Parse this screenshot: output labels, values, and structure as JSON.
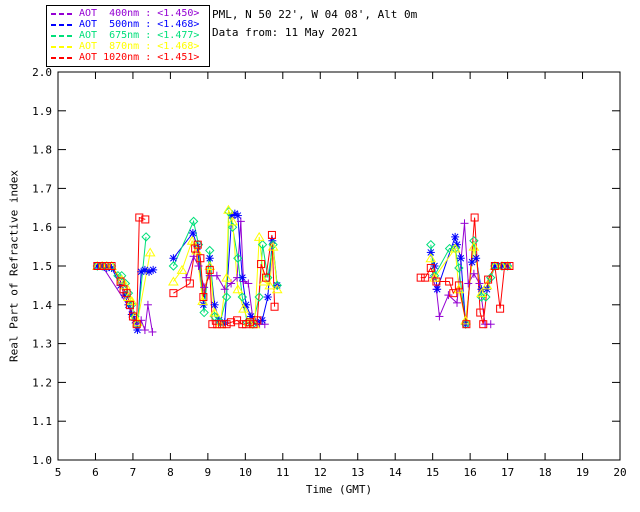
{
  "header": {
    "line1": "PML, N 50 22', W 04 08', Alt 0m",
    "line2": "Data from: 11 May 2021"
  },
  "chart_data": {
    "type": "line",
    "title": "",
    "xlabel": "Time (GMT)",
    "ylabel": "Real Part of Refractive index",
    "xlim": [
      5,
      20
    ],
    "ylim": [
      1.0,
      2.0
    ],
    "x_ticks": [
      "5",
      "6",
      "7",
      "8",
      "9",
      "10",
      "11",
      "12",
      "13",
      "14",
      "15",
      "16",
      "17",
      "18",
      "19",
      "20"
    ],
    "y_ticks": [
      "1.0",
      "1.1",
      "1.2",
      "1.3",
      "1.4",
      "1.5",
      "1.6",
      "1.7",
      "1.8",
      "1.9",
      "2.0"
    ],
    "grid": false,
    "legend_position": "top-left-outside",
    "axis_color": "#000000",
    "series": [
      {
        "name": "AOT 400nm",
        "legend_label": "AOT  400nm : <1.450>",
        "mean_value": "1.450",
        "color": "#9400D3",
        "marker": "plus",
        "segments": [
          [
            [
              6.05,
              1.5
            ],
            [
              6.18,
              1.5
            ],
            [
              6.92,
              1.39
            ],
            [
              7.0,
              1.37
            ],
            [
              7.1,
              1.345
            ],
            [
              7.22,
              1.36
            ],
            [
              7.32,
              1.335
            ],
            [
              7.4,
              1.4
            ],
            [
              7.52,
              1.33
            ]
          ],
          [
            [
              8.42,
              1.47
            ],
            [
              8.62,
              1.525
            ],
            [
              8.75,
              1.5
            ],
            [
              8.9,
              1.445
            ],
            [
              9.05,
              1.475
            ],
            [
              9.24,
              1.475
            ],
            [
              9.45,
              1.44
            ],
            [
              9.62,
              1.455
            ],
            [
              9.78,
              1.47
            ],
            [
              9.88,
              1.615
            ],
            [
              9.95,
              1.46
            ],
            [
              10.08,
              1.455
            ],
            [
              10.22,
              1.35
            ],
            [
              10.38,
              1.35
            ],
            [
              10.52,
              1.35
            ]
          ],
          [
            [
              15.0,
              1.47
            ],
            [
              15.1,
              1.44
            ],
            [
              15.18,
              1.37
            ],
            [
              15.42,
              1.425
            ],
            [
              15.65,
              1.405
            ],
            [
              15.85,
              1.61
            ],
            [
              15.95,
              1.455
            ],
            [
              16.1,
              1.48
            ],
            [
              16.25,
              1.455
            ],
            [
              16.4,
              1.35
            ],
            [
              16.55,
              1.35
            ]
          ]
        ]
      },
      {
        "name": "AOT 500nm",
        "legend_label": "AOT  500nm : <1.468>",
        "mean_value": "1.468",
        "color": "#0000FF",
        "marker": "asterisk",
        "segments": [
          [
            [
              6.05,
              1.5
            ],
            [
              6.18,
              1.5
            ],
            [
              6.3,
              1.495
            ],
            [
              6.43,
              1.495
            ],
            [
              6.67,
              1.45
            ],
            [
              6.78,
              1.425
            ],
            [
              6.88,
              1.4
            ],
            [
              6.97,
              1.375
            ],
            [
              7.05,
              1.36
            ],
            [
              7.12,
              1.335
            ],
            [
              7.22,
              1.485
            ],
            [
              7.32,
              1.49
            ],
            [
              7.43,
              1.485
            ],
            [
              7.54,
              1.49
            ]
          ],
          [
            [
              8.08,
              1.52
            ],
            [
              8.6,
              1.585
            ],
            [
              8.72,
              1.55
            ],
            [
              8.88,
              1.4
            ],
            [
              9.05,
              1.52
            ],
            [
              9.18,
              1.4
            ],
            [
              9.3,
              1.36
            ],
            [
              9.45,
              1.355
            ],
            [
              9.64,
              1.63
            ],
            [
              9.72,
              1.635
            ],
            [
              9.8,
              1.63
            ],
            [
              9.92,
              1.47
            ],
            [
              10.02,
              1.4
            ],
            [
              10.15,
              1.37
            ],
            [
              10.28,
              1.355
            ],
            [
              10.45,
              1.36
            ],
            [
              10.6,
              1.42
            ],
            [
              10.72,
              1.565
            ],
            [
              10.85,
              1.45
            ]
          ],
          [
            [
              14.95,
              1.535
            ],
            [
              15.05,
              1.5
            ],
            [
              15.12,
              1.44
            ],
            [
              15.6,
              1.575
            ],
            [
              15.65,
              1.555
            ],
            [
              15.75,
              1.52
            ],
            [
              15.88,
              1.35
            ],
            [
              16.05,
              1.51
            ],
            [
              16.16,
              1.52
            ],
            [
              16.3,
              1.44
            ],
            [
              16.45,
              1.44
            ],
            [
              16.66,
              1.5
            ],
            [
              16.85,
              1.5
            ],
            [
              17.0,
              1.5
            ]
          ]
        ]
      },
      {
        "name": "AOT 675nm",
        "legend_label": "AOT  675nm : <1.477>",
        "mean_value": "1.477",
        "color": "#00DF7A",
        "marker": "diamond",
        "segments": [
          [
            [
              6.05,
              1.5
            ],
            [
              6.18,
              1.5
            ],
            [
              6.3,
              1.5
            ],
            [
              6.43,
              1.5
            ],
            [
              6.6,
              1.475
            ],
            [
              6.7,
              1.475
            ],
            [
              6.8,
              1.455
            ],
            [
              6.88,
              1.43
            ],
            [
              6.97,
              1.4
            ],
            [
              7.05,
              1.37
            ],
            [
              7.12,
              1.35
            ],
            [
              7.35,
              1.575
            ]
          ],
          [
            [
              8.08,
              1.5
            ],
            [
              8.62,
              1.615
            ],
            [
              8.75,
              1.555
            ],
            [
              8.9,
              1.38
            ],
            [
              9.05,
              1.54
            ],
            [
              9.18,
              1.37
            ],
            [
              9.33,
              1.355
            ],
            [
              9.5,
              1.42
            ],
            [
              9.56,
              1.64
            ],
            [
              9.66,
              1.6
            ],
            [
              9.8,
              1.52
            ],
            [
              9.92,
              1.42
            ],
            [
              10.05,
              1.355
            ],
            [
              10.2,
              1.35
            ],
            [
              10.37,
              1.42
            ],
            [
              10.46,
              1.555
            ],
            [
              10.6,
              1.47
            ],
            [
              10.74,
              1.555
            ],
            [
              10.85,
              1.45
            ]
          ],
          [
            [
              14.95,
              1.555
            ],
            [
              15.05,
              1.475
            ],
            [
              15.45,
              1.545
            ],
            [
              15.6,
              1.545
            ],
            [
              15.7,
              1.495
            ],
            [
              15.88,
              1.35
            ],
            [
              16.1,
              1.565
            ],
            [
              16.3,
              1.42
            ],
            [
              16.42,
              1.42
            ],
            [
              16.55,
              1.47
            ],
            [
              16.66,
              1.5
            ],
            [
              16.85,
              1.5
            ],
            [
              17.0,
              1.5
            ]
          ]
        ]
      },
      {
        "name": "AOT 870nm",
        "legend_label": "AOT  870nm : <1.468>",
        "mean_value": "1.468",
        "color": "#FFFF00",
        "marker": "triangle",
        "segments": [
          [
            [
              6.05,
              1.5
            ],
            [
              6.18,
              1.5
            ],
            [
              6.3,
              1.5
            ],
            [
              6.43,
              1.5
            ],
            [
              6.7,
              1.465
            ],
            [
              6.8,
              1.45
            ],
            [
              6.88,
              1.42
            ],
            [
              6.97,
              1.41
            ],
            [
              7.05,
              1.37
            ],
            [
              7.12,
              1.355
            ],
            [
              7.46,
              1.535
            ]
          ],
          [
            [
              8.08,
              1.46
            ],
            [
              8.31,
              1.49
            ],
            [
              8.58,
              1.565
            ],
            [
              8.7,
              1.54
            ],
            [
              8.86,
              1.41
            ],
            [
              9.05,
              1.5
            ],
            [
              9.18,
              1.38
            ],
            [
              9.33,
              1.35
            ],
            [
              9.5,
              1.47
            ],
            [
              9.55,
              1.645
            ],
            [
              9.66,
              1.615
            ],
            [
              9.8,
              1.44
            ],
            [
              9.95,
              1.39
            ],
            [
              10.1,
              1.355
            ],
            [
              10.25,
              1.35
            ],
            [
              10.37,
              1.575
            ],
            [
              10.5,
              1.46
            ],
            [
              10.65,
              1.45
            ],
            [
              10.74,
              1.55
            ],
            [
              10.85,
              1.44
            ]
          ],
          [
            [
              14.95,
              1.52
            ],
            [
              15.05,
              1.47
            ],
            [
              15.6,
              1.545
            ],
            [
              15.7,
              1.44
            ],
            [
              15.88,
              1.36
            ],
            [
              16.1,
              1.55
            ],
            [
              16.3,
              1.43
            ],
            [
              16.45,
              1.45
            ],
            [
              16.66,
              1.5
            ],
            [
              16.85,
              1.5
            ],
            [
              17.0,
              1.5
            ]
          ]
        ]
      },
      {
        "name": "AOT 1020nm",
        "legend_label": "AOT 1020nm : <1.451>",
        "mean_value": "1.451",
        "color": "#FF0000",
        "marker": "square",
        "segments": [
          [
            [
              6.05,
              1.5
            ],
            [
              6.18,
              1.5
            ],
            [
              6.3,
              1.5
            ],
            [
              6.43,
              1.5
            ],
            [
              6.67,
              1.46
            ],
            [
              6.75,
              1.44
            ],
            [
              6.83,
              1.43
            ],
            [
              6.92,
              1.4
            ],
            [
              7.0,
              1.37
            ],
            [
              7.1,
              1.35
            ],
            [
              7.17,
              1.625
            ],
            [
              7.33,
              1.62
            ]
          ],
          [
            [
              8.08,
              1.43
            ],
            [
              8.52,
              1.455
            ],
            [
              8.66,
              1.545
            ],
            [
              8.73,
              1.555
            ],
            [
              8.8,
              1.52
            ],
            [
              8.88,
              1.42
            ],
            [
              9.05,
              1.49
            ],
            [
              9.12,
              1.35
            ],
            [
              9.25,
              1.35
            ],
            [
              9.38,
              1.35
            ],
            [
              9.5,
              1.35
            ],
            [
              9.62,
              1.355
            ],
            [
              9.78,
              1.36
            ],
            [
              9.92,
              1.35
            ],
            [
              10.02,
              1.35
            ],
            [
              10.12,
              1.355
            ],
            [
              10.22,
              1.35
            ],
            [
              10.32,
              1.36
            ],
            [
              10.42,
              1.505
            ],
            [
              10.55,
              1.47
            ],
            [
              10.71,
              1.58
            ],
            [
              10.78,
              1.395
            ]
          ],
          [
            [
              14.68,
              1.47
            ],
            [
              14.8,
              1.47
            ],
            [
              14.95,
              1.495
            ],
            [
              15.1,
              1.46
            ],
            [
              15.44,
              1.46
            ],
            [
              15.55,
              1.43
            ],
            [
              15.7,
              1.45
            ],
            [
              15.9,
              1.35
            ],
            [
              16.12,
              1.625
            ],
            [
              16.27,
              1.38
            ],
            [
              16.35,
              1.35
            ],
            [
              16.48,
              1.465
            ],
            [
              16.66,
              1.5
            ],
            [
              16.8,
              1.39
            ],
            [
              16.92,
              1.5
            ],
            [
              17.05,
              1.5
            ]
          ]
        ]
      }
    ]
  }
}
